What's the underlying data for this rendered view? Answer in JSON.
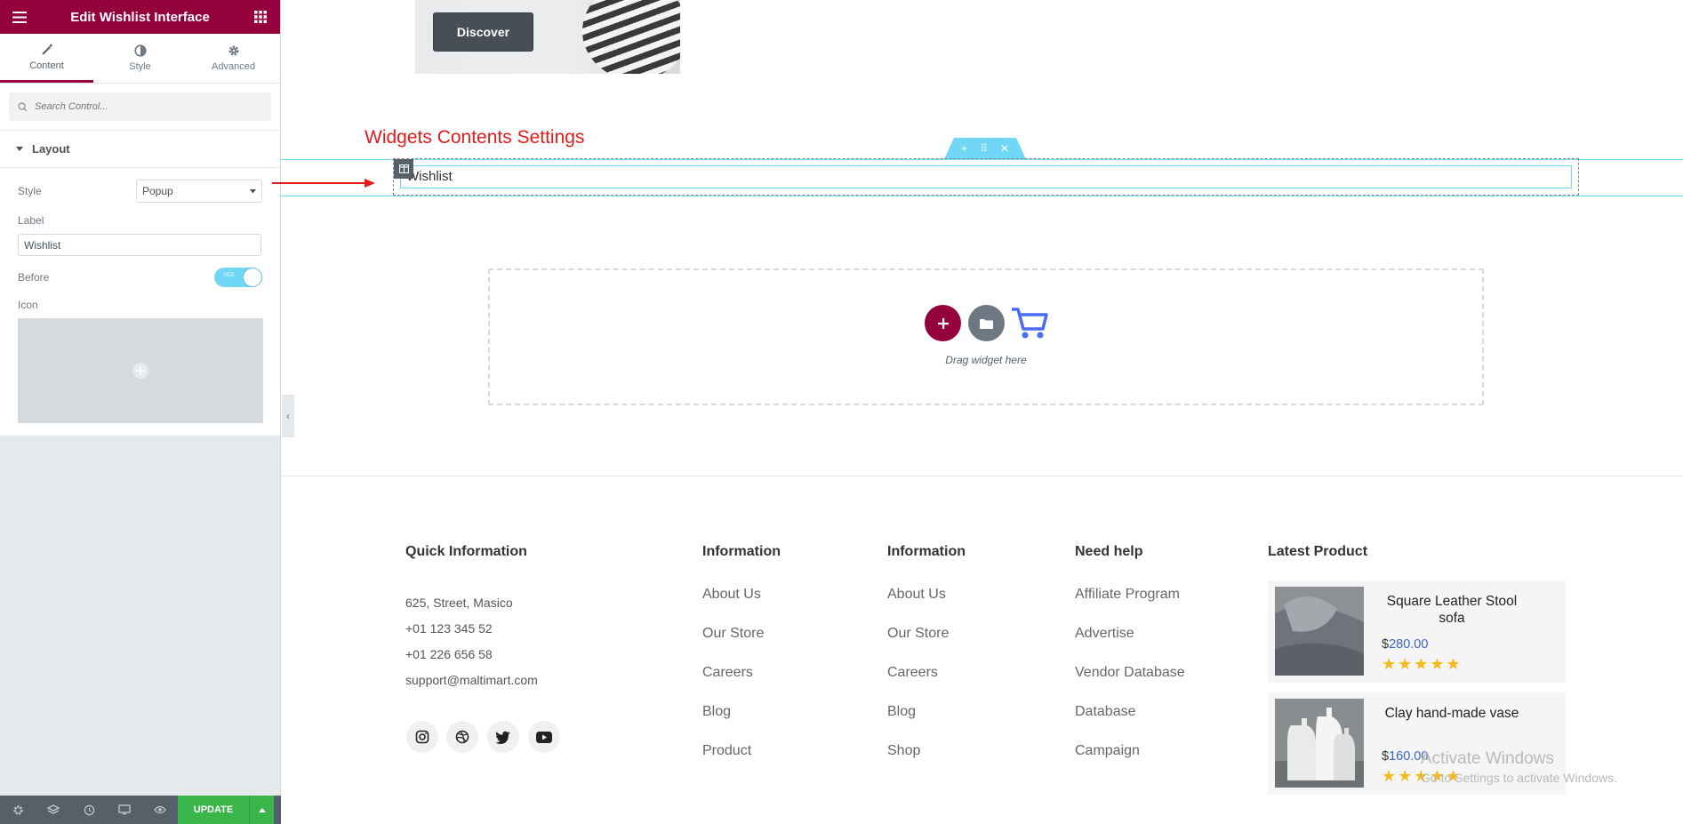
{
  "sidebar": {
    "title": "Edit Wishlist Interface",
    "tabs": [
      {
        "label": "Content",
        "icon": "pencil-icon"
      },
      {
        "label": "Style",
        "icon": "half-circle-icon"
      },
      {
        "label": "Advanced",
        "icon": "gear-icon"
      }
    ],
    "search_placeholder": "Search Control...",
    "section_title": "Layout",
    "style_label": "Style",
    "style_value": "Popup",
    "label_label": "Label",
    "label_value": "Wishlist",
    "before_label": "Before",
    "toggle_text": "YES",
    "icon_label": "Icon",
    "update_label": "UPDATE"
  },
  "canvas": {
    "discover_label": "Discover",
    "annotation": "Widgets Contents Settings",
    "widget_text": "Wishlist",
    "drop_text": "Drag widget here"
  },
  "footer": {
    "quick_info": {
      "title": "Quick Information",
      "lines": [
        "625, Street, Masico",
        "+01 123 345 52",
        "+01 226 656 58",
        "support@maltimart.com"
      ]
    },
    "information1": {
      "title": "Information",
      "links": [
        "About Us",
        "Our Store",
        "Careers",
        "Blog",
        "Product"
      ]
    },
    "information2": {
      "title": "Information",
      "links": [
        "About Us",
        "Our Store",
        "Careers",
        "Blog",
        "Shop"
      ]
    },
    "need_help": {
      "title": "Need help",
      "links": [
        "Affiliate Program",
        "Advertise",
        "Vendor Database",
        "Database",
        "Campaign"
      ]
    },
    "latest": {
      "title": "Latest Product",
      "products": [
        {
          "name": "Square Leather Stool sofa",
          "currency": "$",
          "price": "280.00",
          "stars": "★★★★★"
        },
        {
          "name": "Clay hand-made vase",
          "currency": "$",
          "price": "160.00",
          "stars": "★★★★★"
        }
      ]
    },
    "social": [
      "instagram-icon",
      "dribbble-icon",
      "twitter-icon",
      "youtube-icon"
    ]
  },
  "watermark": {
    "line1": "Activate Windows",
    "line2": "Go to Settings to activate Windows."
  },
  "colors": {
    "brand": "#93003c",
    "accent": "#71d7f7",
    "update": "#39b54a",
    "price": "#3a66c4",
    "star": "#f6b91a",
    "annotation": "#e41b1b"
  }
}
